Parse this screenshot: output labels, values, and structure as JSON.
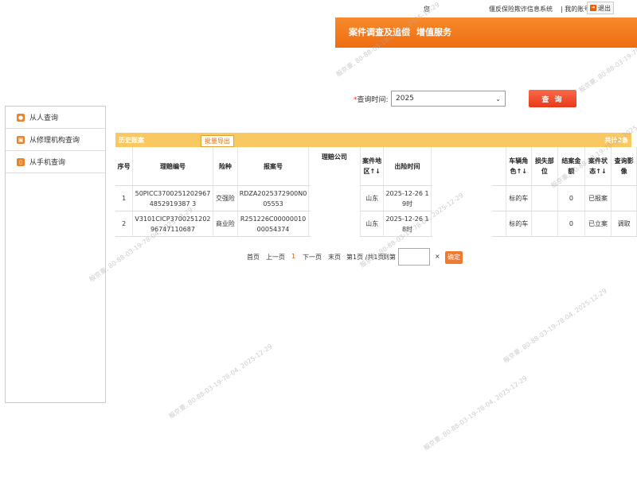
{
  "header": {
    "links": [
      "您",
      "偃反保险欺诈信息系统",
      "| 我的账号"
    ],
    "logout_label": "退出"
  },
  "nav": {
    "items": [
      {
        "label": "案件调查及追偿"
      },
      {
        "label": "增值服务"
      }
    ]
  },
  "query": {
    "label": "查询时间:",
    "required_mark": "*",
    "year_value": "2025",
    "button_label": "查 询"
  },
  "sidebar": {
    "items": [
      {
        "label": "从人查询",
        "icon": "person-icon"
      },
      {
        "label": "从修理机构查询",
        "icon": "repair-shop-icon"
      },
      {
        "label": "从手机查询",
        "icon": "phone-icon"
      }
    ]
  },
  "history": {
    "title": "历史账案",
    "export_label": "批量导出",
    "total_label": "共计2条"
  },
  "table": {
    "headers": [
      "序号",
      "理赔编号",
      "险种",
      "报案号",
      "理赔公司",
      "案件地区↑↓",
      "出险时间",
      "",
      "车辆角色↑↓",
      "损失部位",
      "结案金额",
      "案件状态↑↓",
      "查询影像"
    ],
    "rows": [
      [
        "1",
        "50PICC37002512029674852919387 3",
        "交强险",
        "RDZA2025372900N005553",
        "",
        "山东",
        "2025-12-26 19时",
        "",
        "标的车",
        "",
        "0",
        "已报案",
        ""
      ],
      [
        "2",
        "V3101CICP370025120296747110687",
        "商业险",
        "R251226C0000001000054374",
        "",
        "山东",
        "2025-12-26 18时",
        "",
        "标的车",
        "",
        "0",
        "已立案",
        "调取"
      ]
    ]
  },
  "pager": {
    "first": "首页",
    "prev": "上一页",
    "current": "1",
    "next": "下一页",
    "last": "末页",
    "info": "第1页 /共1页",
    "goto": "到第",
    "go_label": "确定"
  },
  "watermark": {
    "text": "殷京豪, 80-88-03-19-78-04, 2025-12-29"
  },
  "colors": {
    "nav_orange": "#ef6d12",
    "history_bar": "#f9c860",
    "query_button": "#e8391a"
  }
}
